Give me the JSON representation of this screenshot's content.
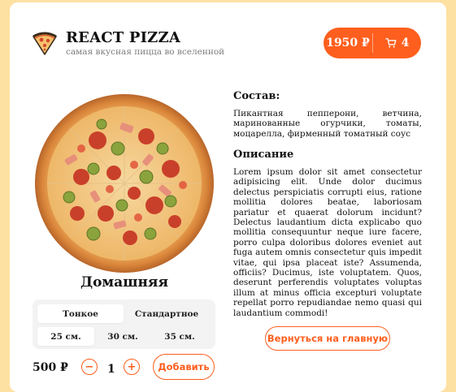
{
  "header": {
    "title": "REACT PIZZA",
    "subtitle": "самая вкусная пицца во вселенной",
    "cart": {
      "price": "1950 ₽",
      "count": "4",
      "icon": "cart-icon"
    }
  },
  "product": {
    "name": "Домашняя",
    "types": [
      {
        "label": "Тонкое",
        "active": true
      },
      {
        "label": "Стандартное",
        "active": false
      }
    ],
    "sizes": [
      {
        "label": "25 см.",
        "active": true
      },
      {
        "label": "30 см.",
        "active": false
      },
      {
        "label": "35 см.",
        "active": false
      }
    ],
    "price": "500 ₽",
    "quantity": "1",
    "minus_label": "−",
    "plus_label": "+",
    "add_label": "Добавить"
  },
  "details": {
    "composition_heading": "Состав:",
    "composition_text": "Пикантная пепперони, ветчина, маринованные огурчики, томаты, моцарелла, фирменный томатный соус",
    "description_heading": "Описание",
    "description_text": "Lorem ipsum dolor sit amet consectetur adipisicing elit. Unde dolor ducimus delectus perspiciatis corrupti eius, ratione mollitia dolores beatae, laboriosam pariatur et quaerat dolorum incidunt? Delectus laudantium dicta explicabo quo mollitia consequuntur neque iure facere, porro culpa doloribus dolores eveniet aut fuga autem omnis consectetur quis impedit vitae, qui ipsa placeat iste? Assumenda, officiis? Ducimus, iste voluptatem. Quos, deserunt perferendis voluptates voluptas illum at minus officia excepturi voluptate repellat porro repudiandae nemo quasi qui laudantium commodi!",
    "back_label": "Вернуться на главную"
  },
  "colors": {
    "accent": "#fe5f1e",
    "background": "#fde1a3",
    "selector_bg": "#f3f3f3"
  }
}
